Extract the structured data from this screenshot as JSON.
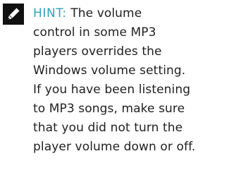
{
  "note": {
    "icon": "pencil-icon",
    "label": "HINT:",
    "lines": [
      "The volume",
      "control in some MP3",
      "players overrides the",
      "Windows volume setting.",
      "If you have been listening",
      "to MP3 songs, make sure",
      "that you did not turn the",
      "player volume down or off."
    ],
    "colors": {
      "label": "#2fa3b6",
      "text": "#1f1f1f",
      "icon": "#111111"
    }
  }
}
